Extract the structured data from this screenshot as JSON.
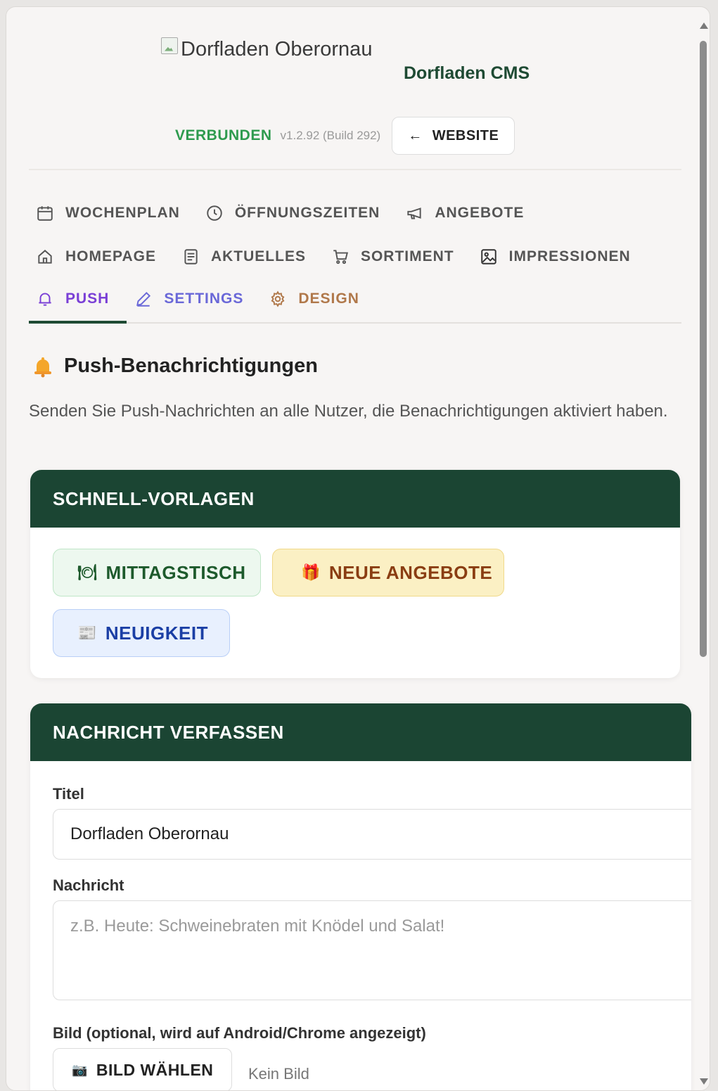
{
  "header": {
    "logo_alt": "Dorfladen Oberornau",
    "cms_title": "Dorfladen CMS",
    "status": "VERBUNDEN",
    "version": "v1.2.92 (Build 292)",
    "website_button": "WEBSITE"
  },
  "nav": {
    "row1": [
      {
        "label": "WOCHENPLAN",
        "icon": "calendar-icon"
      },
      {
        "label": "ÖFFNUNGSZEITEN",
        "icon": "clock-icon"
      },
      {
        "label": "ANGEBOTE",
        "icon": "megaphone-icon"
      }
    ],
    "row2": [
      {
        "label": "HOMEPAGE",
        "icon": "home-icon"
      },
      {
        "label": "AKTUELLES",
        "icon": "news-icon"
      },
      {
        "label": "SORTIMENT",
        "icon": "cart-icon"
      },
      {
        "label": "IMPRESSIONEN",
        "icon": "image-icon"
      }
    ],
    "row3": [
      {
        "label": "PUSH",
        "icon": "bell-icon"
      },
      {
        "label": "SETTINGS",
        "icon": "pencil-icon"
      },
      {
        "label": "DESIGN",
        "icon": "gear-icon"
      }
    ],
    "active": "PUSH"
  },
  "section": {
    "title": "Push-Benachrichtigungen",
    "description": "Senden Sie Push-Nachrichten an alle Nutzer, die Benachrichtigungen aktiviert haben."
  },
  "templates": {
    "heading": "SCHNELL-VORLAGEN",
    "buttons": [
      {
        "label": "MITTAGSTISCH",
        "emoji": "🍽"
      },
      {
        "label": "NEUE ANGEBOTE",
        "emoji": "🎁"
      },
      {
        "label": "NEUIGKEIT",
        "emoji": "📰"
      }
    ]
  },
  "compose": {
    "heading": "NACHRICHT VERFASSEN",
    "title_label": "Titel",
    "title_value": "Dorfladen Oberornau",
    "message_label": "Nachricht",
    "message_placeholder": "z.B. Heute: Schweinebraten mit Knödel und Salat!",
    "image_label": "Bild (optional, wird auf Android/Chrome angezeigt)",
    "image_button": "BILD WÄHLEN",
    "image_status": "Kein Bild"
  },
  "colors": {
    "brand_dark_green": "#1b4533",
    "status_green": "#2e9b4e",
    "push_purple": "#7a3fd6"
  }
}
